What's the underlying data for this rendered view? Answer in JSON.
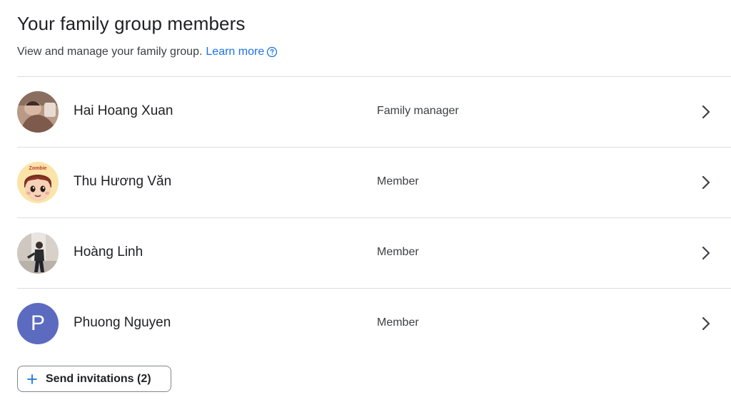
{
  "header": {
    "title": "Your family group members",
    "subtitle": "View and manage your family group.",
    "learn_more": "Learn more"
  },
  "members": [
    {
      "name": "Hai Hoang Xuan",
      "role": "Family manager",
      "avatar": "photo"
    },
    {
      "name": "Thu Hương Văn",
      "role": "Member",
      "avatar": "zombie-cartoon",
      "avatar_text": "Zombie"
    },
    {
      "name": "Hoàng Linh",
      "role": "Member",
      "avatar": "photo"
    },
    {
      "name": "Phuong Nguyen",
      "role": "Member",
      "avatar": "letter",
      "initial": "P",
      "avatar_color": "#5c6bc0"
    }
  ],
  "actions": {
    "send_invitations": "Send invitations (2)"
  },
  "colors": {
    "link": "#1a73e8",
    "divider": "#dadce0",
    "text": "#202124"
  }
}
